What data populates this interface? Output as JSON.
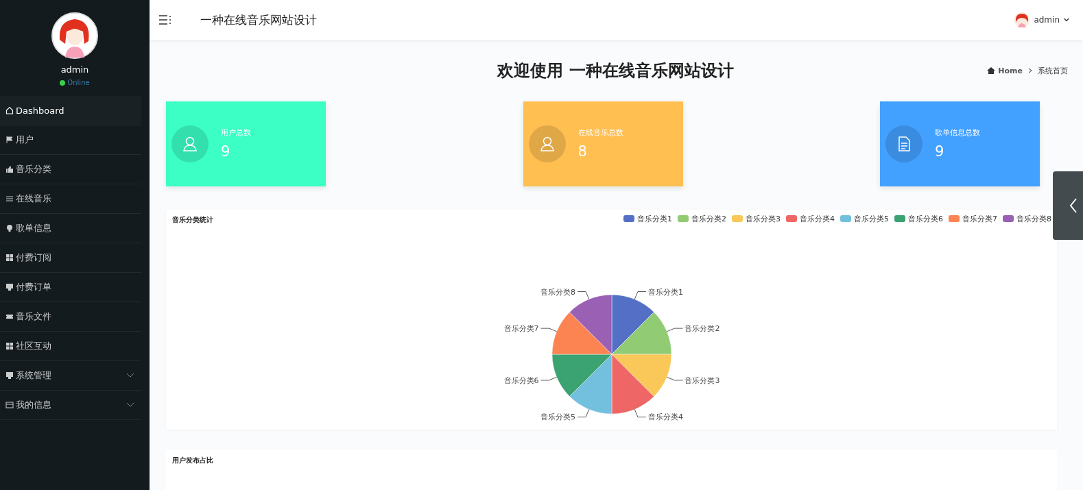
{
  "sidebar": {
    "user": {
      "name": "admin",
      "status": "Online"
    },
    "items": [
      {
        "label": "Dashboard",
        "kind": "home",
        "selected": true,
        "expandable": false
      },
      {
        "label": "用户",
        "kind": "flag",
        "selected": false,
        "expandable": false
      },
      {
        "label": "音乐分类",
        "kind": "thumb",
        "selected": false,
        "expandable": false
      },
      {
        "label": "在线音乐",
        "kind": "sliders",
        "selected": false,
        "expandable": false
      },
      {
        "label": "歌单信息",
        "kind": "bulb",
        "selected": false,
        "expandable": false
      },
      {
        "label": "付费订阅",
        "kind": "grid",
        "selected": false,
        "expandable": false
      },
      {
        "label": "付费订单",
        "kind": "monitor",
        "selected": false,
        "expandable": false
      },
      {
        "label": "音乐文件",
        "kind": "ticket",
        "selected": false,
        "expandable": false
      },
      {
        "label": "社区互动",
        "kind": "grid",
        "selected": false,
        "expandable": false
      },
      {
        "label": "系统管理",
        "kind": "monitor",
        "selected": false,
        "expandable": true
      },
      {
        "label": "我的信息",
        "kind": "card",
        "selected": false,
        "expandable": true
      }
    ]
  },
  "header": {
    "title": "一种在线音乐网站设计",
    "user": "admin"
  },
  "page": {
    "title": "欢迎使用 一种在线音乐网站设计",
    "breadcrumb": [
      "Home",
      "系统首页"
    ]
  },
  "stats": [
    {
      "label": "用户总数",
      "value": "9",
      "kind": "user",
      "color": "#3bffc5"
    },
    {
      "label": "在线音乐总数",
      "value": "8",
      "kind": "user",
      "color": "#ffbf51"
    },
    {
      "label": "歌单信息总数",
      "value": "9",
      "kind": "doc",
      "color": "#42a0ff"
    }
  ],
  "panels": [
    {
      "title": "音乐分类统计",
      "chart_data": {
        "type": "pie",
        "categories": [
          "音乐分类1",
          "音乐分类2",
          "音乐分类3",
          "音乐分类4",
          "音乐分类5",
          "音乐分类6",
          "音乐分类7",
          "音乐分类8"
        ],
        "series": [
          {
            "colors": [
              "#5470c6",
              "#91cc75",
              "#fac858",
              "#ee6666",
              "#73c0de",
              "#3ba272",
              "#fc8452",
              "#9a60b4"
            ],
            "values": [
              1,
              1,
              1,
              1,
              1,
              1,
              1,
              1
            ]
          }
        ]
      }
    },
    {
      "title": "用户发布占比"
    }
  ]
}
